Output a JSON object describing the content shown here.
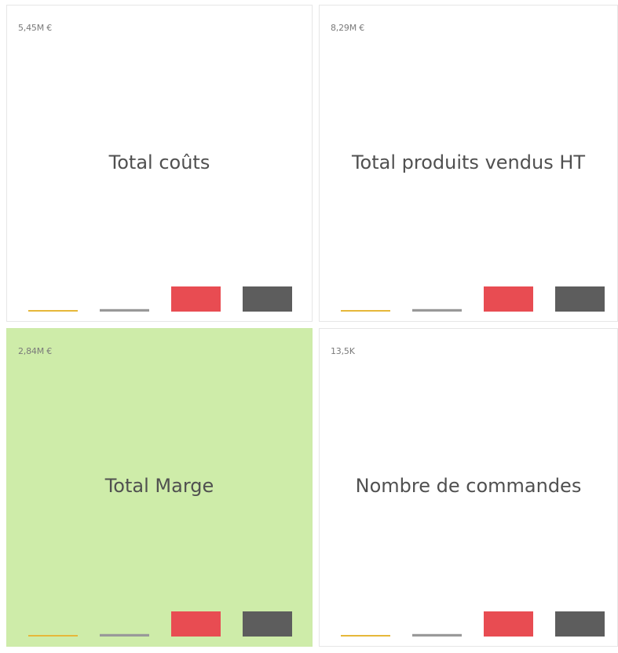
{
  "chart_data": [
    {
      "type": "bar",
      "title": "Total coûts",
      "value_label": "5,45M €",
      "background": "#ffffff",
      "categories": [
        "",
        "",
        "",
        ""
      ],
      "values": [
        0.03,
        0.1,
        1,
        1
      ],
      "bar_colors": [
        "#e6b83a",
        "#999999",
        "#e84c52",
        "#5d5d5d"
      ]
    },
    {
      "type": "bar",
      "title": "Total produits vendus HT",
      "value_label": "8,29M €",
      "background": "#ffffff",
      "categories": [
        "",
        "",
        "",
        ""
      ],
      "values": [
        0.03,
        0.1,
        1,
        1
      ],
      "bar_colors": [
        "#e6b83a",
        "#999999",
        "#e84c52",
        "#5d5d5d"
      ]
    },
    {
      "type": "bar",
      "title": "Total Marge",
      "value_label": "2,84M €",
      "background": "#ceeca9",
      "categories": [
        "",
        "",
        "",
        ""
      ],
      "values": [
        0.03,
        0.1,
        1,
        1
      ],
      "bar_colors": [
        "#e6b83a",
        "#999999",
        "#e84c52",
        "#5d5d5d"
      ]
    },
    {
      "type": "bar",
      "title": "Nombre de commandes",
      "value_label": "13,5K",
      "background": "#ffffff",
      "categories": [
        "",
        "",
        "",
        ""
      ],
      "values": [
        0.03,
        0.1,
        1,
        1
      ],
      "bar_colors": [
        "#e6b83a",
        "#999999",
        "#e84c52",
        "#5d5d5d"
      ]
    }
  ]
}
